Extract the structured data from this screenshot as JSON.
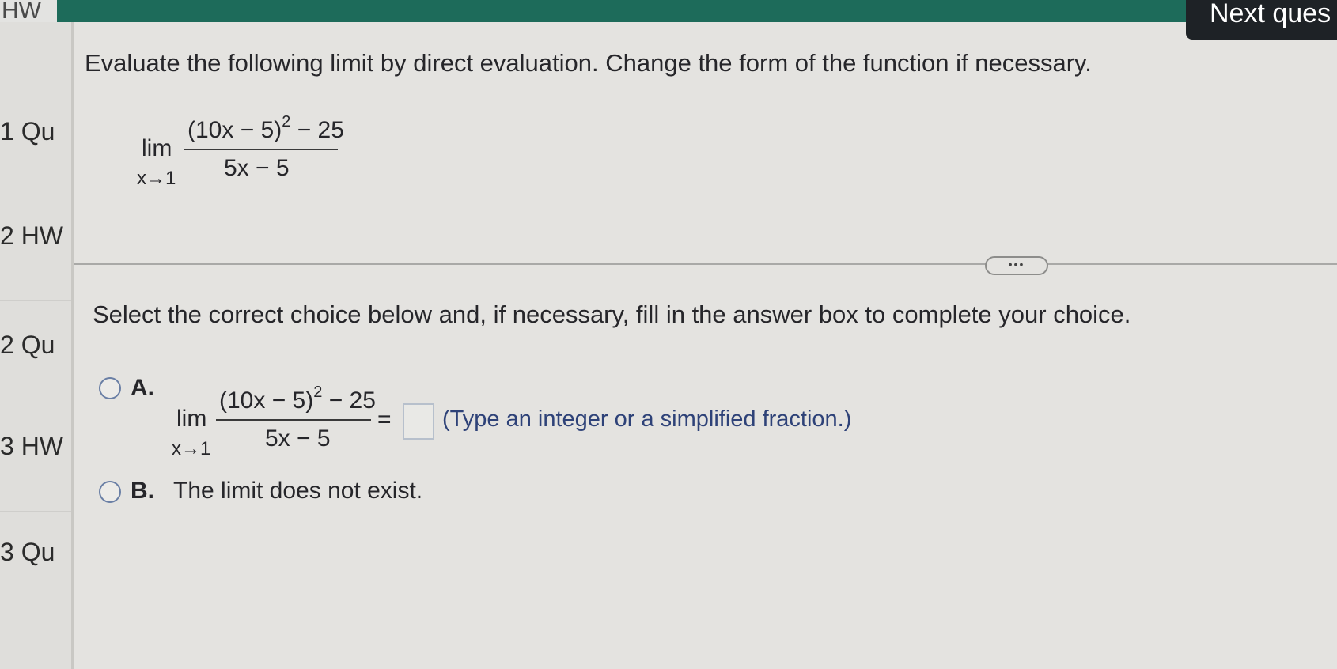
{
  "topbar": {
    "left_label": "HW",
    "next_button_label": "Next ques"
  },
  "sidebar": {
    "items": [
      {
        "label": "1 Qu"
      },
      {
        "label": "2 HW"
      },
      {
        "label": "2 Qu"
      },
      {
        "label": "3 HW"
      },
      {
        "label": "3 Qu"
      }
    ]
  },
  "question": {
    "prompt": "Evaluate the following limit by direct evaluation. Change the form of the function if necessary.",
    "limit": {
      "lim": "lim",
      "approach": "x→1",
      "numerator_base": "(10x − 5)",
      "numerator_exp": "2",
      "numerator_rest": " − 25",
      "denominator": "5x − 5"
    }
  },
  "more_button_label": "•••",
  "instruction": "Select the correct choice below and, if necessary, fill in the answer box to complete your choice.",
  "choices": {
    "a": {
      "label": "A.",
      "lim": "lim",
      "approach": "x→1",
      "numerator_base": "(10x − 5)",
      "numerator_exp": "2",
      "numerator_rest": " − 25",
      "denominator": "5x − 5",
      "equals": "=",
      "answer_value": "",
      "hint": "(Type an integer or a simplified fraction.)"
    },
    "b": {
      "label": "B.",
      "text": "The limit does not exist."
    }
  },
  "colors": {
    "topbar": "#1d6b5a",
    "next_button": "#1e2226",
    "hint_text": "#2e4278"
  }
}
